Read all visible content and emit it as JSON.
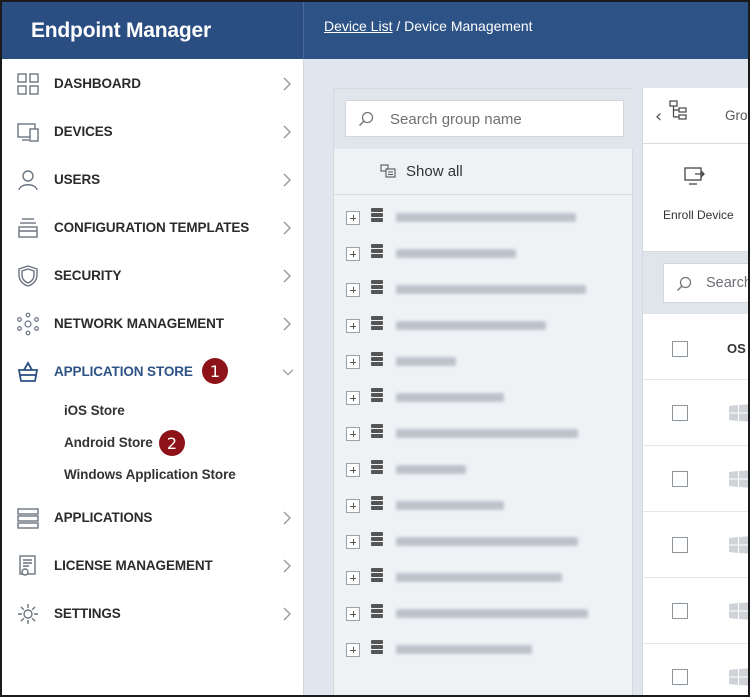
{
  "header": {
    "brand": "Endpoint Manager",
    "breadcrumb_link": "Device List",
    "breadcrumb_sep": " / ",
    "breadcrumb_current": "Device Management"
  },
  "sidebar": {
    "items": [
      {
        "label": "DASHBOARD",
        "icon": "dashboard-icon"
      },
      {
        "label": "DEVICES",
        "icon": "devices-icon"
      },
      {
        "label": "USERS",
        "icon": "user-icon"
      },
      {
        "label": "CONFIGURATION TEMPLATES",
        "icon": "templates-icon"
      },
      {
        "label": "SECURITY",
        "icon": "shield-icon"
      },
      {
        "label": "NETWORK MANAGEMENT",
        "icon": "network-icon"
      },
      {
        "label": "APPLICATION STORE",
        "icon": "basket-icon",
        "expanded": true
      },
      {
        "label": "APPLICATIONS",
        "icon": "applications-icon"
      },
      {
        "label": "LICENSE MANAGEMENT",
        "icon": "license-icon"
      },
      {
        "label": "SETTINGS",
        "icon": "gear-icon"
      }
    ],
    "store_sub_items": [
      "iOS Store",
      "Android Store",
      "Windows Application Store"
    ],
    "badges": [
      "1",
      "2"
    ]
  },
  "groups": {
    "search_placeholder": "Search group name",
    "show_all": "Show all",
    "row_count": 13
  },
  "device_pane": {
    "groups_tab": "Grou",
    "enroll_label": "Enroll Device",
    "search_placeholder": "Search",
    "os_header": "OS"
  },
  "colors": {
    "header": "#2d5286",
    "badge": "#8e1318",
    "active": "#2d5286"
  }
}
